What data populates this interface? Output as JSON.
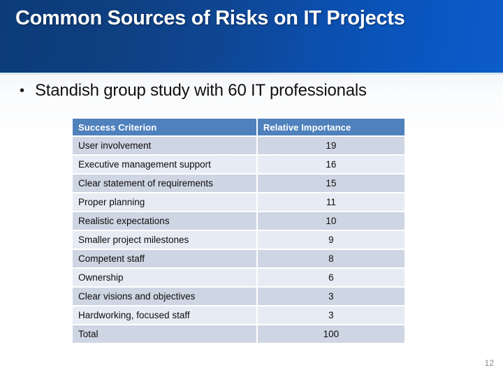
{
  "slide": {
    "title": "Common Sources of Risks on IT Projects",
    "page_number": "12",
    "accent_color": "#0d3b79",
    "banner_color_right": "#0c5cca",
    "table_header_color": "#4f81bd",
    "row_color_odd": "#ced5e3",
    "row_color_even": "#e7ebf3"
  },
  "bullet": {
    "marker": "•",
    "text": "Standish group study with 60 IT professionals"
  },
  "table": {
    "columns": [
      "Success Criterion",
      "Relative Importance"
    ],
    "rows": [
      {
        "criterion": "User involvement",
        "importance": "19"
      },
      {
        "criterion": "Executive management support",
        "importance": "16"
      },
      {
        "criterion": "Clear statement of requirements",
        "importance": "15"
      },
      {
        "criterion": "Proper planning",
        "importance": "11"
      },
      {
        "criterion": "Realistic expectations",
        "importance": "10"
      },
      {
        "criterion": "Smaller project milestones",
        "importance": "9"
      },
      {
        "criterion": "Competent staff",
        "importance": "8"
      },
      {
        "criterion": "Ownership",
        "importance": "6"
      },
      {
        "criterion": "Clear visions and objectives",
        "importance": "3"
      },
      {
        "criterion": "Hardworking, focused staff",
        "importance": "3"
      },
      {
        "criterion": "Total",
        "importance": "100"
      }
    ]
  }
}
